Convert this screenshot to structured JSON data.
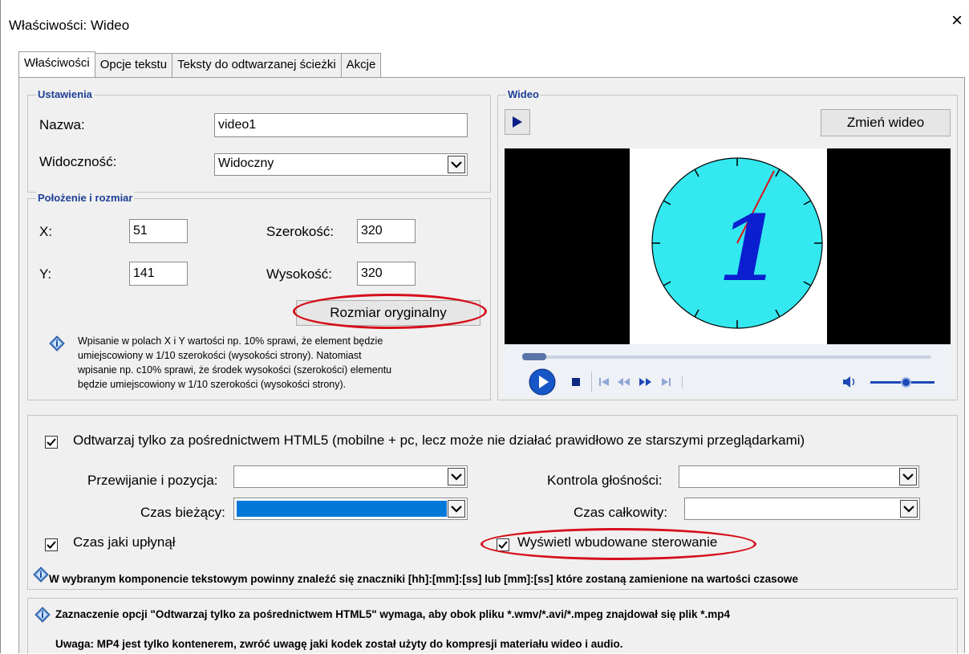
{
  "window": {
    "title": "Właściwości: Wideo",
    "close_glyph": "×"
  },
  "tabs": [
    "Właściwości",
    "Opcje tekstu",
    "Teksty do odtwarzanej ścieżki",
    "Akcje"
  ],
  "settings": {
    "legend": "Ustawienia",
    "name_label": "Nazwa:",
    "name_value": "video1",
    "visibility_label": "Widoczność:",
    "visibility_value": "Widoczny"
  },
  "position": {
    "legend": "Położenie i rozmiar",
    "x_label": "X:",
    "x_value": "51",
    "y_label": "Y:",
    "y_value": "141",
    "width_label": "Szerokość:",
    "width_value": "320",
    "height_label": "Wysokość:",
    "height_value": "320",
    "original_size_button": "Rozmiar oryginalny",
    "info_lines": [
      "Wpisanie w polach X i Y wartości np. 10% sprawi, że element będzie",
      "umiejscowiony w 1/10 szerokości (wysokości strony). Natomiast",
      "wpisanie np. c10% sprawi, że środek wysokości (szerokości) elementu",
      "będzie umiejscowiony w 1/10 szerokości (wysokości strony)."
    ]
  },
  "video": {
    "legend": "Wideo",
    "change_button": "Zmień wideo",
    "clock_digit": "1"
  },
  "html5": {
    "only_html5_label": "Odtwarzaj tylko za pośrednictwem HTML5 (mobilne + pc, lecz może nie działać prawidłowo ze starszymi przeglądarkami)",
    "only_html5_checked": true,
    "seek_label": "Przewijanie i pozycja:",
    "volume_label": "Kontrola głośności:",
    "current_time_label": "Czas bieżący:",
    "total_time_label": "Czas całkowity:",
    "elapsed_label": "Czas jaki upłynął",
    "elapsed_checked": true,
    "builtin_controls_label": "Wyświetl wbudowane sterowanie",
    "builtin_controls_checked": true,
    "hint": "W wybranym komponencie tekstowym powinny znaleźć się znaczniki [hh]:[mm]:[ss] lub [mm]:[ss] które zostaną zamienione na wartości czasowe"
  },
  "notes": {
    "line1": "Zaznaczenie opcji \"Odtwarzaj tylko za pośrednictwem HTML5\" wymaga, aby obok pliku *.wmv/*.avi/*.mpeg znajdował się plik *.mp4",
    "line2": "Uwaga: MP4 jest tylko kontenerem, zwróć uwagę jaki kodek został użyty do kompresji materiału wideo i audio."
  },
  "colors": {
    "legend": "#1c3f95",
    "highlight": "#d5101b",
    "clock_face": "#33e8ef",
    "selection": "#0078d7"
  }
}
